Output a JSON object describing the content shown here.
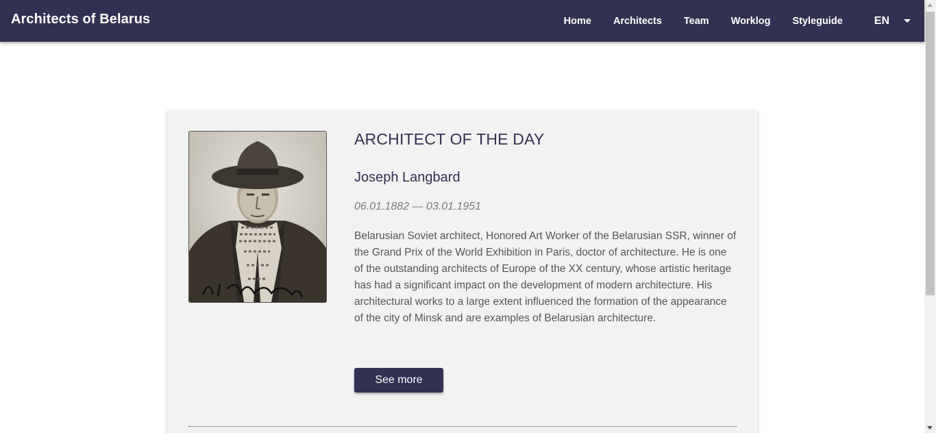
{
  "header": {
    "brand": "Architects of Belarus",
    "nav": [
      "Home",
      "Architects",
      "Team",
      "Worklog",
      "Styleguide"
    ],
    "language": "EN"
  },
  "architect_of_day": {
    "section_title": "ARCHITECT OF THE DAY",
    "name": "Joseph Langbard",
    "dates": "06.01.1882 — 03.01.1951",
    "bio": "Belarusian Soviet architect, Honored Art Worker of the Belarusian SSR, winner of the Grand Prix of the World Exhibition in Paris, doctor of architecture. He is one of the outstanding architects of Europe of the XX century, whose artistic heritage has had a significant impact on the development of modern architecture. His architectural works to a large extent influenced the formation of the appearance of the city of Minsk and are examples of Belarusian architecture.",
    "see_more_label": "See more",
    "portrait_signature": "И. Лангбард"
  },
  "colors": {
    "header_bg": "#323152",
    "card_bg": "#f2f2f2",
    "accent": "#323152"
  },
  "icons": {
    "language_caret": "caret-down-icon"
  }
}
